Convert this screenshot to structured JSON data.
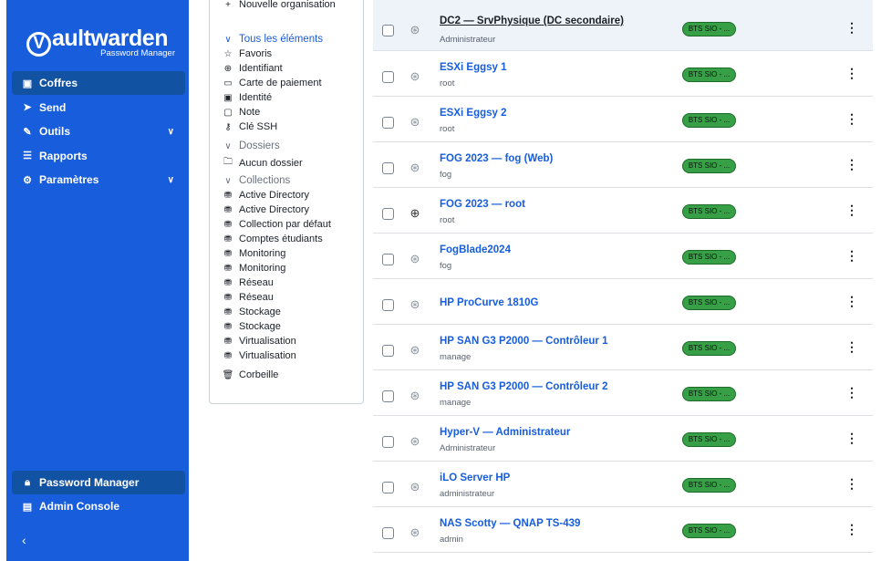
{
  "sidebar": {
    "logo_word": "aultwarden",
    "logo_v": "V",
    "logo_sub": "Password Manager",
    "items": [
      {
        "label": "Coffres",
        "icon": "vault-icon"
      },
      {
        "label": "Send",
        "icon": "send-icon"
      },
      {
        "label": "Outils",
        "icon": "tools-icon"
      },
      {
        "label": "Rapports",
        "icon": "reports-icon"
      },
      {
        "label": "Paramètres",
        "icon": "settings-icon"
      }
    ],
    "bottom": [
      {
        "label": "Password Manager",
        "icon": "lock-icon"
      },
      {
        "label": "Admin Console",
        "icon": "building-icon"
      }
    ],
    "collapse": "‹"
  },
  "filters": {
    "partial_top": "Nouvelle organisation",
    "all_items": "Tous les éléments",
    "types": [
      "Favoris",
      "Identifiant",
      "Carte de paiement",
      "Identité",
      "Note",
      "Clé SSH"
    ],
    "folders_head": "Dossiers",
    "no_folder": "Aucun dossier",
    "collections_head": "Collections",
    "collections": [
      "Active Directory",
      "Active Directory",
      "Collection par défaut",
      "Comptes étudiants",
      "Monitoring",
      "Monitoring",
      "Réseau",
      "Réseau",
      "Stockage",
      "Stockage",
      "Virtualisation",
      "Virtualisation"
    ],
    "trash": "Corbeille"
  },
  "items": [
    {
      "name": "DC2 — SrvPhysique (DC secondaire)",
      "user": "Administrateur",
      "badge": "BTS SIO - ...",
      "icon": "favicon-icon"
    },
    {
      "name": "ESXi Eggsy 1",
      "user": "root",
      "badge": "BTS SIO - ...",
      "icon": "favicon-icon"
    },
    {
      "name": "ESXi Eggsy 2",
      "user": "root",
      "badge": "BTS SIO - ...",
      "icon": "favicon-icon"
    },
    {
      "name": "FOG 2023 — fog (Web)",
      "user": "fog",
      "badge": "BTS SIO - ...",
      "icon": "favicon-icon"
    },
    {
      "name": "FOG 2023 — root",
      "user": "root",
      "badge": "BTS SIO - ...",
      "icon": "globe-icon"
    },
    {
      "name": "FogBlade2024",
      "user": "fog",
      "badge": "BTS SIO - ...",
      "icon": "favicon-icon"
    },
    {
      "name": "HP ProCurve 1810G",
      "user": "",
      "badge": "BTS SIO - ...",
      "icon": "favicon-icon"
    },
    {
      "name": "HP SAN G3 P2000 — Contrôleur 1",
      "user": "manage",
      "badge": "BTS SIO - ...",
      "icon": "favicon-icon"
    },
    {
      "name": "HP SAN G3 P2000 — Contrôleur 2",
      "user": "manage",
      "badge": "BTS SIO - ...",
      "icon": "favicon-icon"
    },
    {
      "name": "Hyper-V — Administrateur",
      "user": "Administrateur",
      "badge": "BTS SIO - ...",
      "icon": "favicon-icon"
    },
    {
      "name": "iLO Server HP",
      "user": "administrateur",
      "badge": "BTS SIO - ...",
      "icon": "favicon-icon"
    },
    {
      "name": "NAS Scotty — QNAP TS-439",
      "user": "admin",
      "badge": "BTS SIO - ...",
      "icon": "favicon-icon"
    }
  ],
  "colors": {
    "brand": "#175ddc",
    "badge": "#37a047"
  }
}
